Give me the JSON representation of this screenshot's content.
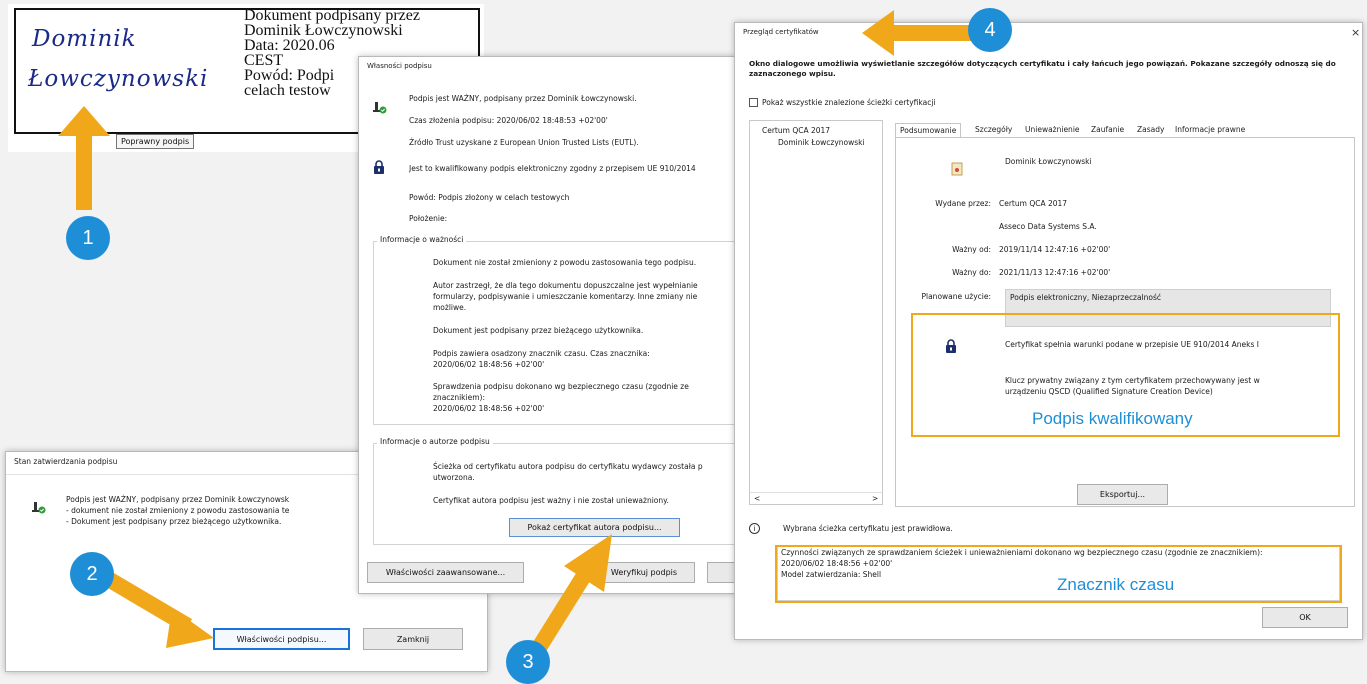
{
  "signature_stamp": {
    "handwritten_name_line1": "Dominik",
    "handwritten_name_line2": "Łowczynowski",
    "text_lines": [
      "Dokument podpisany przez",
      "Dominik Łowczynowski",
      "Data: 2020.06",
      "CEST",
      "Powód: Podpi",
      "celach testow"
    ],
    "tooltip": "Poprawny podpis"
  },
  "validation_dialog": {
    "title": "Stan zatwierdzania podpisu",
    "line1": "Podpis jest WAŻNY, podpisany przez Dominik Łowczynowsk",
    "line2": "- dokument nie został zmieniony z powodu zastosowania te",
    "line3": "- Dokument jest podpisany przez bieżącego użytkownika.",
    "btn_properties": "Właściwości podpisu...",
    "btn_close": "Zamknij"
  },
  "properties_dialog": {
    "title": "Własności podpisu",
    "status": "Podpis jest WAŻNY, podpisany przez Dominik Łowczynowski.",
    "signing_time": "Czas złożenia podpisu:  2020/06/02 18:48:53 +02'00'",
    "trust_source": "Źródło Trust uzyskane z European Union Trusted Lists (EUTL).",
    "qualified": "Jest to kwalifikowany podpis elektroniczny zgodny z przepisem UE 910/2014",
    "reason": "Powód:  Podpis złożony w celach testowych",
    "location": "Położenie:",
    "validity_group": "Informacje o ważności",
    "validity_1": "Dokument nie został zmieniony z powodu zastosowania tego podpisu.",
    "validity_2a": "Autor zastrzegł, że dla tego dokumentu dopuszczalne jest wypełnianie",
    "validity_2b": "formularzy, podpisywanie i umieszczanie komentarzy. Inne zmiany nie",
    "validity_2c": "możliwe.",
    "validity_3": "Dokument jest podpisany przez bieżącego użytkownika.",
    "validity_4a": "Podpis zawiera osadzony znacznik czasu. Czas znacznika:",
    "validity_4b": "2020/06/02 18:48:56 +02'00'",
    "validity_5a": "Sprawdzenia podpisu dokonano wg bezpiecznego czasu (zgodnie ze",
    "validity_5b": "znacznikiem):",
    "validity_5c": "2020/06/02 18:48:56 +02'00'",
    "author_group": "Informacje o autorze podpisu",
    "author_1a": "Ścieżka od certyfikatu autora podpisu do certyfikatu wydawcy została p",
    "author_1b": "utworzona.",
    "author_2": "Certyfikat autora podpisu jest ważny i nie został unieważniony.",
    "btn_show_cert": "Pokaż certyfikat autora podpisu...",
    "btn_advanced": "Właściwości zaawansowane...",
    "btn_verify": "Weryfikuj podpis"
  },
  "cert_viewer": {
    "title": "Przegląd certyfikatów",
    "close": "×",
    "intro_1": "Okno dialogowe umożliwia wyświetlanie szczegółów dotyczących certyfikatu i cały łańcuch jego powiązań. Pokazane szczegóły",
    "intro_2": "odnoszą się do zaznaczonego wpisu.",
    "checkbox_label": "Pokaż wszystkie znalezione ścieżki certyfikacji",
    "tree": [
      "Certum QCA 2017",
      "Dominik Łowczynowski"
    ],
    "tabs": [
      "Podsumowanie",
      "Szczegóły",
      "Unieważnienie",
      "Zaufanie",
      "Zasady",
      "Informacje prawne"
    ],
    "subject": "Dominik Łowczynowski",
    "issued_by_label": "Wydane przez:",
    "issued_by_1": "Certum QCA 2017",
    "issued_by_2": "Asseco Data Systems S.A.",
    "valid_from_label": "Ważny od:",
    "valid_from": "2019/11/14 12:47:16 +02'00'",
    "valid_to_label": "Ważny do:",
    "valid_to": "2021/11/13 12:47:16 +02'00'",
    "usage_label": "Planowane użycie:",
    "usage": "Podpis elektroniczny, Niezaprzeczalność",
    "compliance": "Certyfikat spełnia warunki podane w przepisie UE 910/2014 Aneks I",
    "qscd_1": "Klucz prywatny związany z tym certyfikatem przechowywany jest w",
    "qscd_2": "urządzeniu QSCD (Qualified Signature Creation Device)",
    "qualified_caption": "Podpis kwalifikowany",
    "btn_export": "Eksportuj...",
    "path_valid": "Wybrana ścieżka certyfikatu jest prawidłowa.",
    "ts_1": "Czynności związanych ze sprawdzaniem ścieżek i unieważnieniami dokonano wg bezpiecznego czasu (zgodnie ze znacznikiem):",
    "ts_2": "2020/06/02 18:48:56 +02'00'",
    "ts_3": "Model zatwierdzania: Shell",
    "timestamp_caption": "Znacznik czasu",
    "btn_ok": "OK",
    "scroll_left": "<",
    "scroll_right": ">"
  },
  "step_badges": [
    "1",
    "2",
    "3",
    "4"
  ],
  "colors": {
    "arrow": "#f0a81a",
    "badge": "#1e8fd6",
    "caption": "#1e8fd6"
  }
}
